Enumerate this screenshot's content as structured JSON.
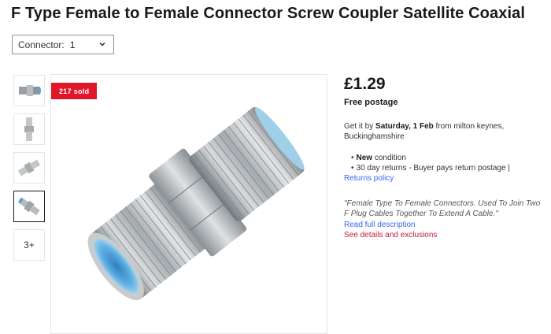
{
  "title": "F Type Female to Female Connector Screw Coupler Satellite Coaxial",
  "variant": {
    "label": "Connector:",
    "value": "1"
  },
  "gallery": {
    "more_label": "3+",
    "selected_index": 3
  },
  "badge": "217 sold",
  "price": "£1.29",
  "postage": "Free postage",
  "delivery": {
    "prefix": "Get it by",
    "date": "Saturday, 1 Feb",
    "suffix": "from milton keynes,",
    "line2": "Buckinghamshire"
  },
  "condition": {
    "value": "New",
    "suffix": "condition"
  },
  "returns_text": "30 day returns - Buyer pays return postage |",
  "returns_link": "Returns policy",
  "description_quote": "\"Female Type To Female Connectors. Used To Join Two F Plug Cables Together To Extend A Cable.\"",
  "read_full": "Read full description",
  "see_details": "See details and exclusions",
  "colors": {
    "link": "#3665f3",
    "badge": "#e0162b",
    "details": "#c11c3b"
  }
}
